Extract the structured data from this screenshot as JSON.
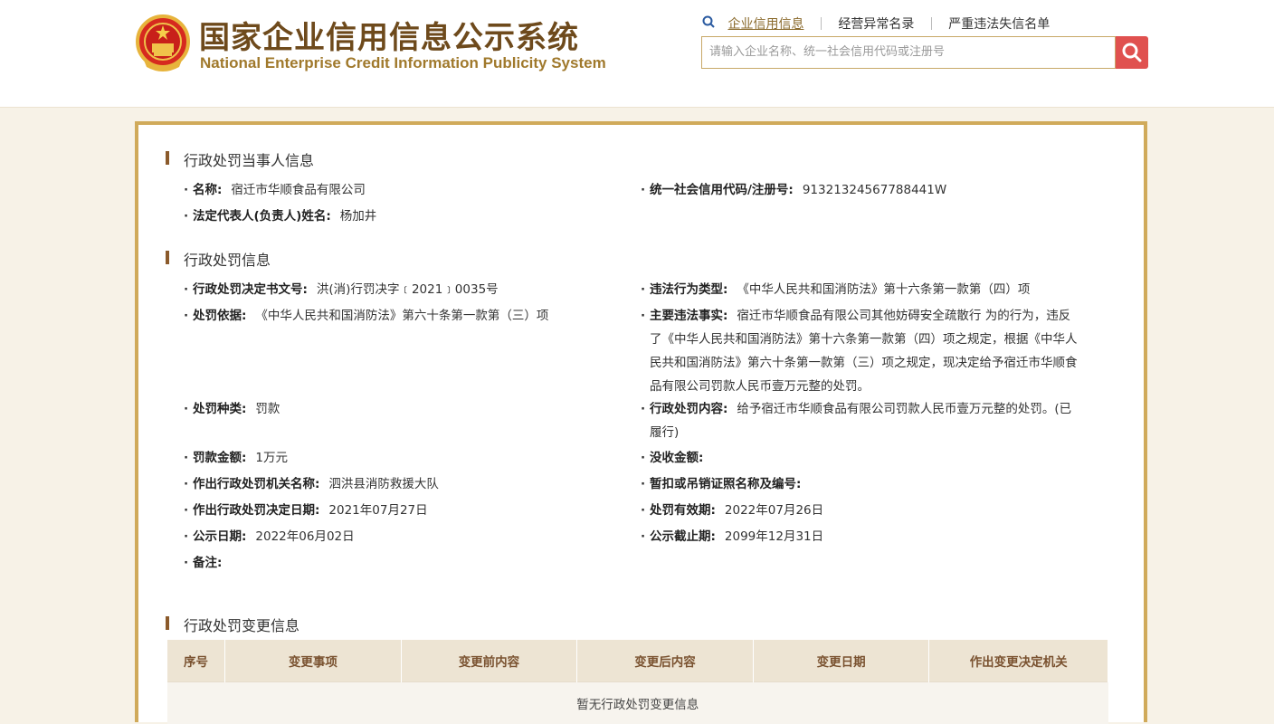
{
  "header": {
    "title_cn": "国家企业信用信息公示系统",
    "title_en": "National Enterprise Credit Information Publicity System",
    "links": [
      "企业信用信息",
      "经营异常名录",
      "严重违法失信名单"
    ],
    "search_placeholder": "请输入企业名称、统一社会信用代码或注册号"
  },
  "party": {
    "section_title": "行政处罚当事人信息",
    "name_label": "名称:",
    "name_value": "宿迁市华顺食品有限公司",
    "code_label": "统一社会信用代码/注册号:",
    "code_value": "91321324567788441W",
    "rep_label": "法定代表人(负责人)姓名:",
    "rep_value": "杨加井"
  },
  "penalty": {
    "section_title": "行政处罚信息",
    "doc_no_label": "行政处罚决定书文号:",
    "doc_no_value": "洪(消)行罚决字﹝2021﹞0035号",
    "violation_type_label": "违法行为类型:",
    "violation_type_value": "《中华人民共和国消防法》第十六条第一款第（四）项",
    "basis_label": "处罚依据:",
    "basis_value": "《中华人民共和国消防法》第六十条第一款第（三）项",
    "facts_label": "主要违法事实:",
    "facts_line1": "宿迁市华顺食品有限公司其他妨碍安全疏散行 为的行为，违反",
    "facts_line2": "了《中华人民共和国消防法》第十六条第一款第（四）项之规定，根据《中华人",
    "facts_line3": "民共和国消防法》第六十条第一款第（三）项之规定，现决定给予宿迁市华顺食",
    "facts_line4": "品有限公司罚款人民币壹万元整的处罚。",
    "kind_label": "处罚种类:",
    "kind_value": "罚款",
    "content_label": "行政处罚内容:",
    "content_line1": "给予宿迁市华顺食品有限公司罚款人民币壹万元整的处罚。(已",
    "content_line2": "履行)",
    "amount_label": "罚款金额:",
    "amount_value": "1万元",
    "confiscate_label": "没收金额:",
    "confiscate_value": "",
    "authority_label": "作出行政处罚机关名称:",
    "authority_value": "泗洪县消防救援大队",
    "license_label": "暂扣或吊销证照名称及编号:",
    "license_value": "",
    "decision_date_label": "作出行政处罚决定日期:",
    "decision_date_value": "2021年07月27日",
    "valid_label": "处罚有效期:",
    "valid_value": "2022年07月26日",
    "publish_label": "公示日期:",
    "publish_value": "2022年06月02日",
    "deadline_label": "公示截止期:",
    "deadline_value": "2099年12月31日",
    "remark_label": "备注:",
    "remark_value": ""
  },
  "changes": {
    "section_title": "行政处罚变更信息",
    "columns": [
      "序号",
      "变更事项",
      "变更前内容",
      "变更后内容",
      "变更日期",
      "作出变更决定机关"
    ],
    "empty_text": "暂无行政处罚变更信息"
  }
}
